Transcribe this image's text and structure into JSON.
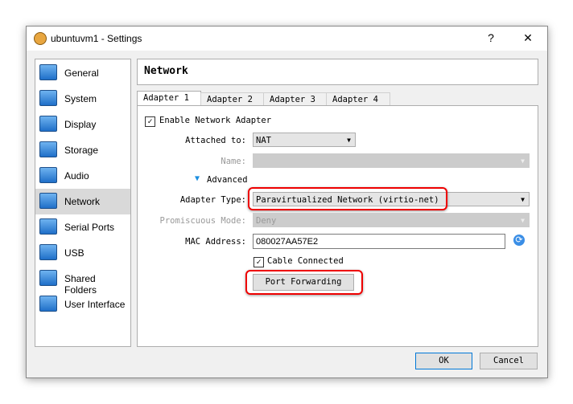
{
  "window": {
    "title": "ubuntuvm1 - Settings",
    "help": "?",
    "close": "✕"
  },
  "sidebar": {
    "items": [
      {
        "label": "General",
        "icon": "monitor-icon"
      },
      {
        "label": "System",
        "icon": "chip-icon"
      },
      {
        "label": "Display",
        "icon": "display-icon"
      },
      {
        "label": "Storage",
        "icon": "disk-icon"
      },
      {
        "label": "Audio",
        "icon": "speaker-icon"
      },
      {
        "label": "Network",
        "icon": "network-icon",
        "selected": true
      },
      {
        "label": "Serial Ports",
        "icon": "serial-port-icon"
      },
      {
        "label": "USB",
        "icon": "usb-icon"
      },
      {
        "label": "Shared Folders",
        "icon": "folder-icon"
      },
      {
        "label": "User Interface",
        "icon": "window-icon"
      }
    ]
  },
  "header": {
    "title": "Network"
  },
  "tabs": [
    "Adapter 1",
    "Adapter 2",
    "Adapter 3",
    "Adapter 4"
  ],
  "form": {
    "enable_label": "Enable Network Adapter",
    "enable_checked": true,
    "attached_label": "Attached to:",
    "attached_value": "NAT",
    "name_label": "Name:",
    "name_value": "",
    "advanced_label": "Advanced",
    "adapter_type_label": "Adapter Type:",
    "adapter_type_value": "Paravirtualized Network (virtio-net)",
    "promisc_label": "Promiscuous Mode:",
    "promisc_value": "Deny",
    "mac_label": "MAC Address:",
    "mac_value": "080027AA57E2",
    "cable_label": "Cable Connected",
    "cable_checked": true,
    "port_forwarding": "Port Forwarding"
  },
  "buttons": {
    "ok": "OK",
    "cancel": "Cancel"
  },
  "highlight_color": "#e00000"
}
